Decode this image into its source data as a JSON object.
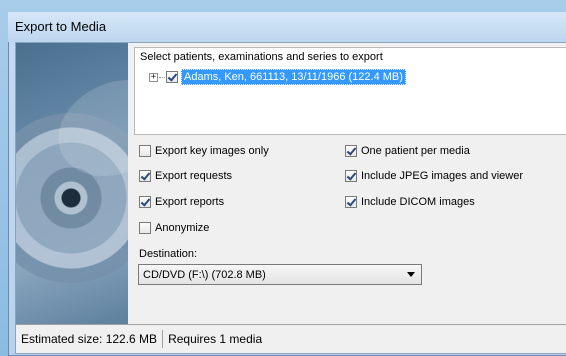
{
  "window": {
    "title": "Export to Media"
  },
  "selection": {
    "label": "Select patients, examinations and series to export",
    "tree": [
      {
        "expander": "+",
        "checked": true,
        "label": "Adams, Ken, 661113, 13/11/1966 (122.4 MB)"
      }
    ]
  },
  "options": {
    "key_images_only": {
      "label": "Export key images only",
      "checked": false
    },
    "requests": {
      "label": "Export requests",
      "checked": true
    },
    "reports": {
      "label": "Export reports",
      "checked": true
    },
    "anonymize": {
      "label": "Anonymize",
      "checked": false
    },
    "one_patient_per_media": {
      "label": "One patient per media",
      "checked": true
    },
    "include_jpeg": {
      "label": "Include JPEG images and viewer",
      "checked": true
    },
    "include_dicom": {
      "label": "Include DICOM images",
      "checked": true
    }
  },
  "destination": {
    "label": "Destination:",
    "selected": "CD/DVD (F:\\) (702.8 MB)"
  },
  "status": {
    "estimated_size": "Estimated size: 122.6 MB",
    "requires": "Requires 1 media"
  },
  "colors": {
    "selection": "#3399ff",
    "window_frame": "#b7d2ee"
  },
  "icons": {
    "banner": "disc-icon"
  }
}
